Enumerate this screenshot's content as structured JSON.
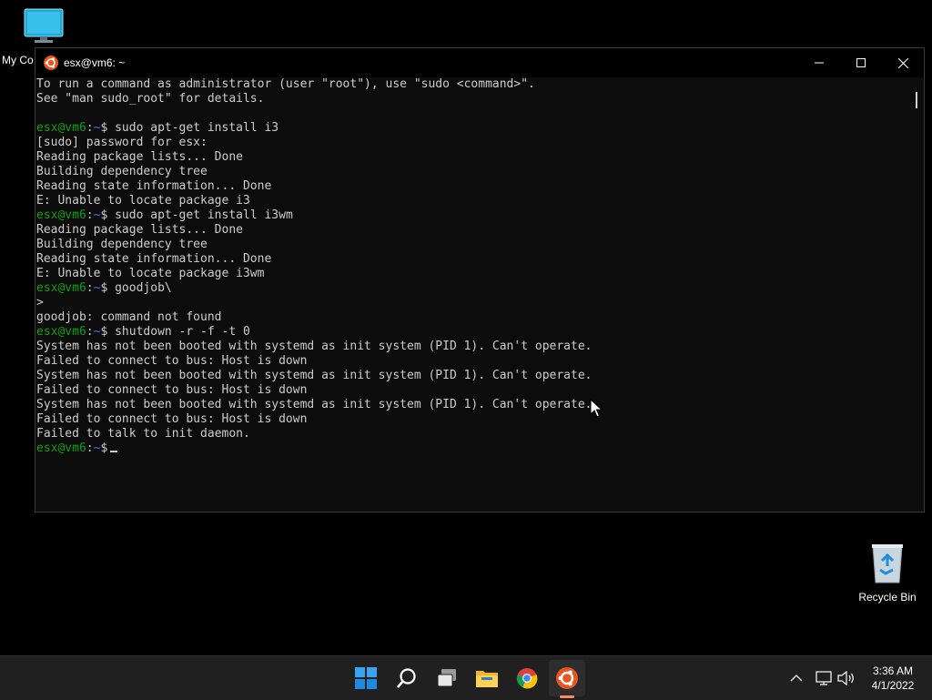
{
  "desktop": {
    "my_computer_label": "My Co",
    "recycle_bin_label": "Recycle Bin"
  },
  "window": {
    "title": "esx@vm6: ~",
    "icon": "ubuntu-icon",
    "controls": [
      "minimize-icon",
      "maximize-icon",
      "close-icon"
    ]
  },
  "terminal": {
    "lines": [
      {
        "text": "To run a command as administrator (user \"root\"), use \"sudo <command>\"."
      },
      {
        "text": "See \"man sudo_root\" for details."
      },
      {
        "text": ""
      },
      {
        "user": "esx@vm6",
        "path": "~",
        "cmd": "$ sudo apt-get install i3"
      },
      {
        "text": "[sudo] password for esx:"
      },
      {
        "text": "Reading package lists... Done"
      },
      {
        "text": "Building dependency tree"
      },
      {
        "text": "Reading state information... Done"
      },
      {
        "text": "E: Unable to locate package i3"
      },
      {
        "user": "esx@vm6",
        "path": "~",
        "cmd": "$ sudo apt-get install i3wm"
      },
      {
        "text": "Reading package lists... Done"
      },
      {
        "text": "Building dependency tree"
      },
      {
        "text": "Reading state information... Done"
      },
      {
        "text": "E: Unable to locate package i3wm"
      },
      {
        "user": "esx@vm6",
        "path": "~",
        "cmd": "$ goodjob\\"
      },
      {
        "text": ">"
      },
      {
        "text": "goodjob: command not found"
      },
      {
        "user": "esx@vm6",
        "path": "~",
        "cmd": "$ shutdown -r -f -t 0"
      },
      {
        "text": "System has not been booted with systemd as init system (PID 1). Can't operate."
      },
      {
        "text": "Failed to connect to bus: Host is down"
      },
      {
        "text": "System has not been booted with systemd as init system (PID 1). Can't operate."
      },
      {
        "text": "Failed to connect to bus: Host is down"
      },
      {
        "text": "System has not been booted with systemd as init system (PID 1). Can't operate."
      },
      {
        "text": "Failed to connect to bus: Host is down"
      },
      {
        "text": "Failed to talk to init daemon."
      },
      {
        "user": "esx@vm6",
        "path": "~",
        "cmd": "$",
        "cursor": true
      }
    ],
    "prompt_sep": ":"
  },
  "taskbar": {
    "items": [
      "windows-start-icon",
      "search-icon",
      "task-view-icon",
      "file-explorer-icon",
      "chrome-icon",
      "ubuntu-icon"
    ],
    "tray": [
      "chevron-up-icon",
      "network-icon",
      "volume-icon"
    ],
    "time": "3:36 AM",
    "date": "4/1/2022"
  },
  "colors": {
    "terminal_bg": "#0c0c0c",
    "prompt_user": "#13a10e",
    "prompt_path": "#3b78ff",
    "ubuntu_orange": "#e95420"
  }
}
